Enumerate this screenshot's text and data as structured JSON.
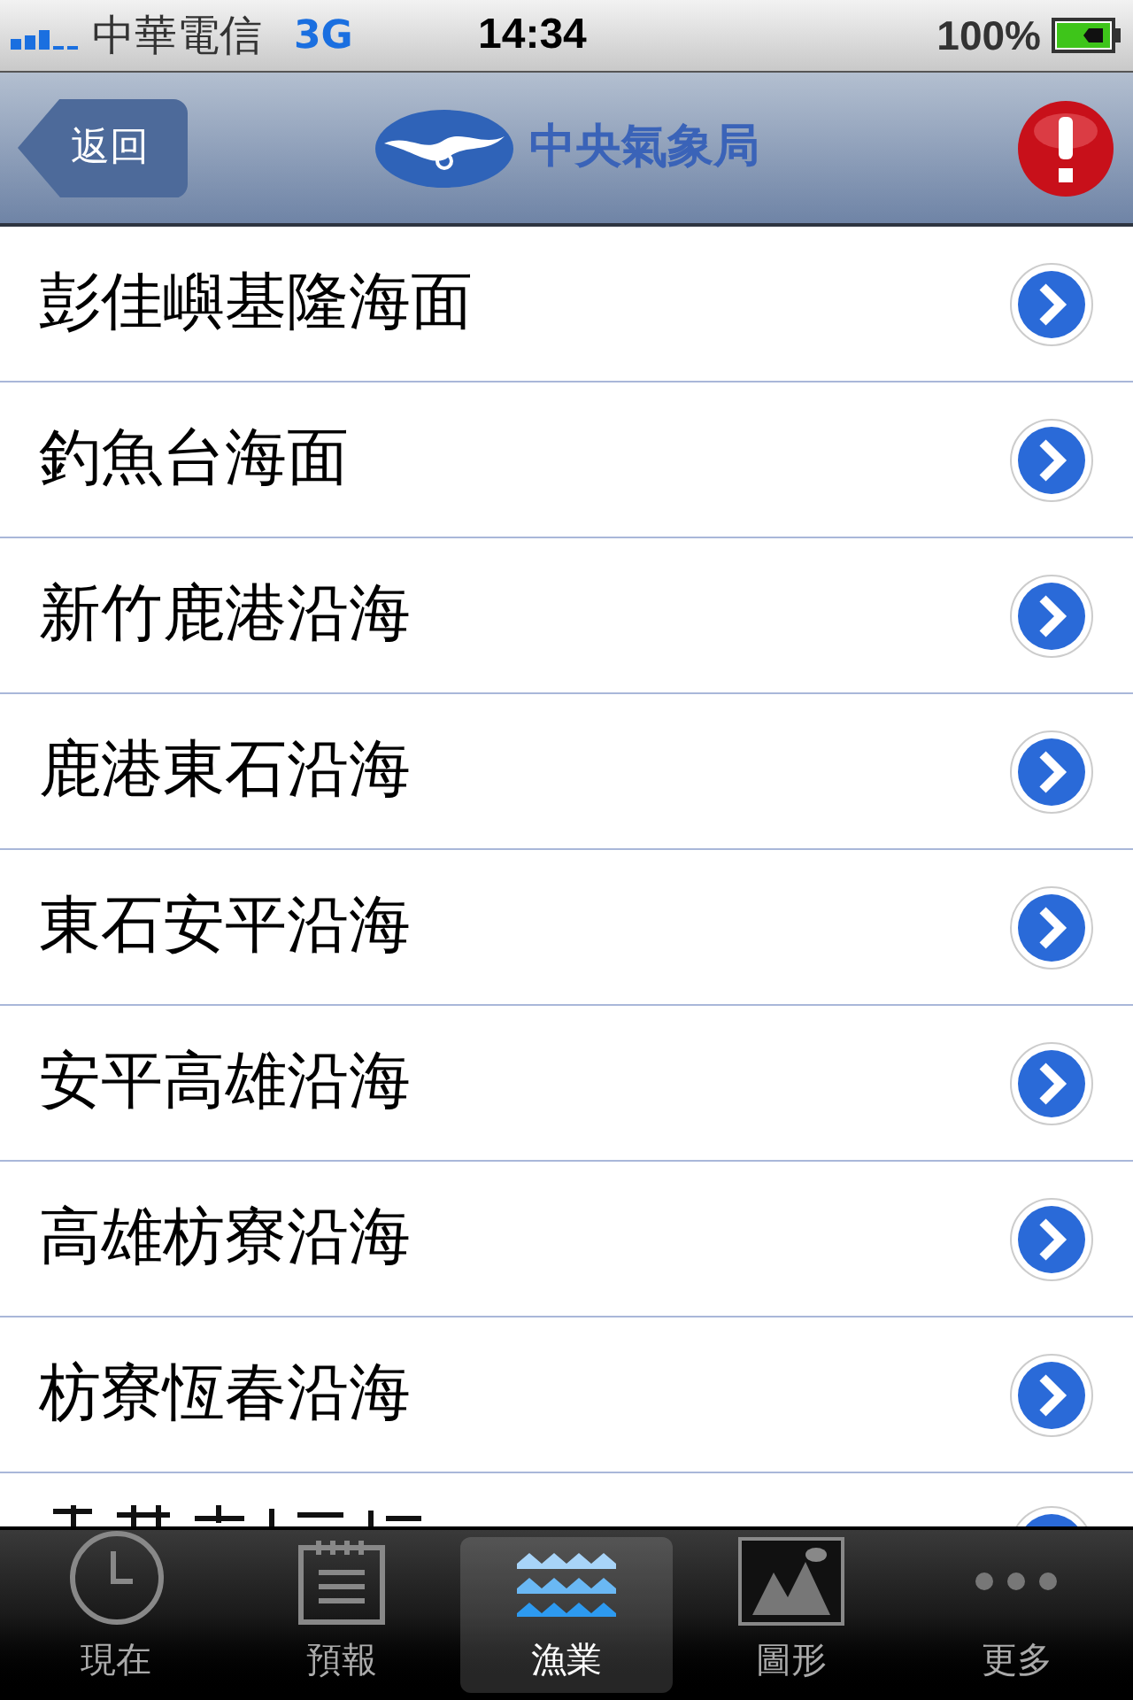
{
  "status_bar": {
    "carrier": "中華電信",
    "network": "3G",
    "time": "14:34",
    "battery": "100%"
  },
  "nav_bar": {
    "back": "返回",
    "title": "中央氣象局"
  },
  "rows": [
    {
      "label": "彭佳嶼基隆海面"
    },
    {
      "label": "釣魚台海面"
    },
    {
      "label": "新竹鹿港沿海"
    },
    {
      "label": "鹿港東石沿海"
    },
    {
      "label": "東石安平沿海"
    },
    {
      "label": "安平高雄沿海"
    },
    {
      "label": "高雄枋寮沿海"
    },
    {
      "label": "枋寮恆春沿海"
    },
    {
      "kind": "cut_off"
    }
  ],
  "tab_bar": [
    {
      "label": "現在",
      "kind": "clock",
      "selected": false
    },
    {
      "label": "預報",
      "kind": "notepad",
      "selected": false
    },
    {
      "label": "漁業",
      "kind": "waves",
      "selected": true
    },
    {
      "label": "圖形",
      "kind": "image",
      "selected": false
    },
    {
      "label": "更多",
      "kind": "dots",
      "selected": false
    }
  ]
}
